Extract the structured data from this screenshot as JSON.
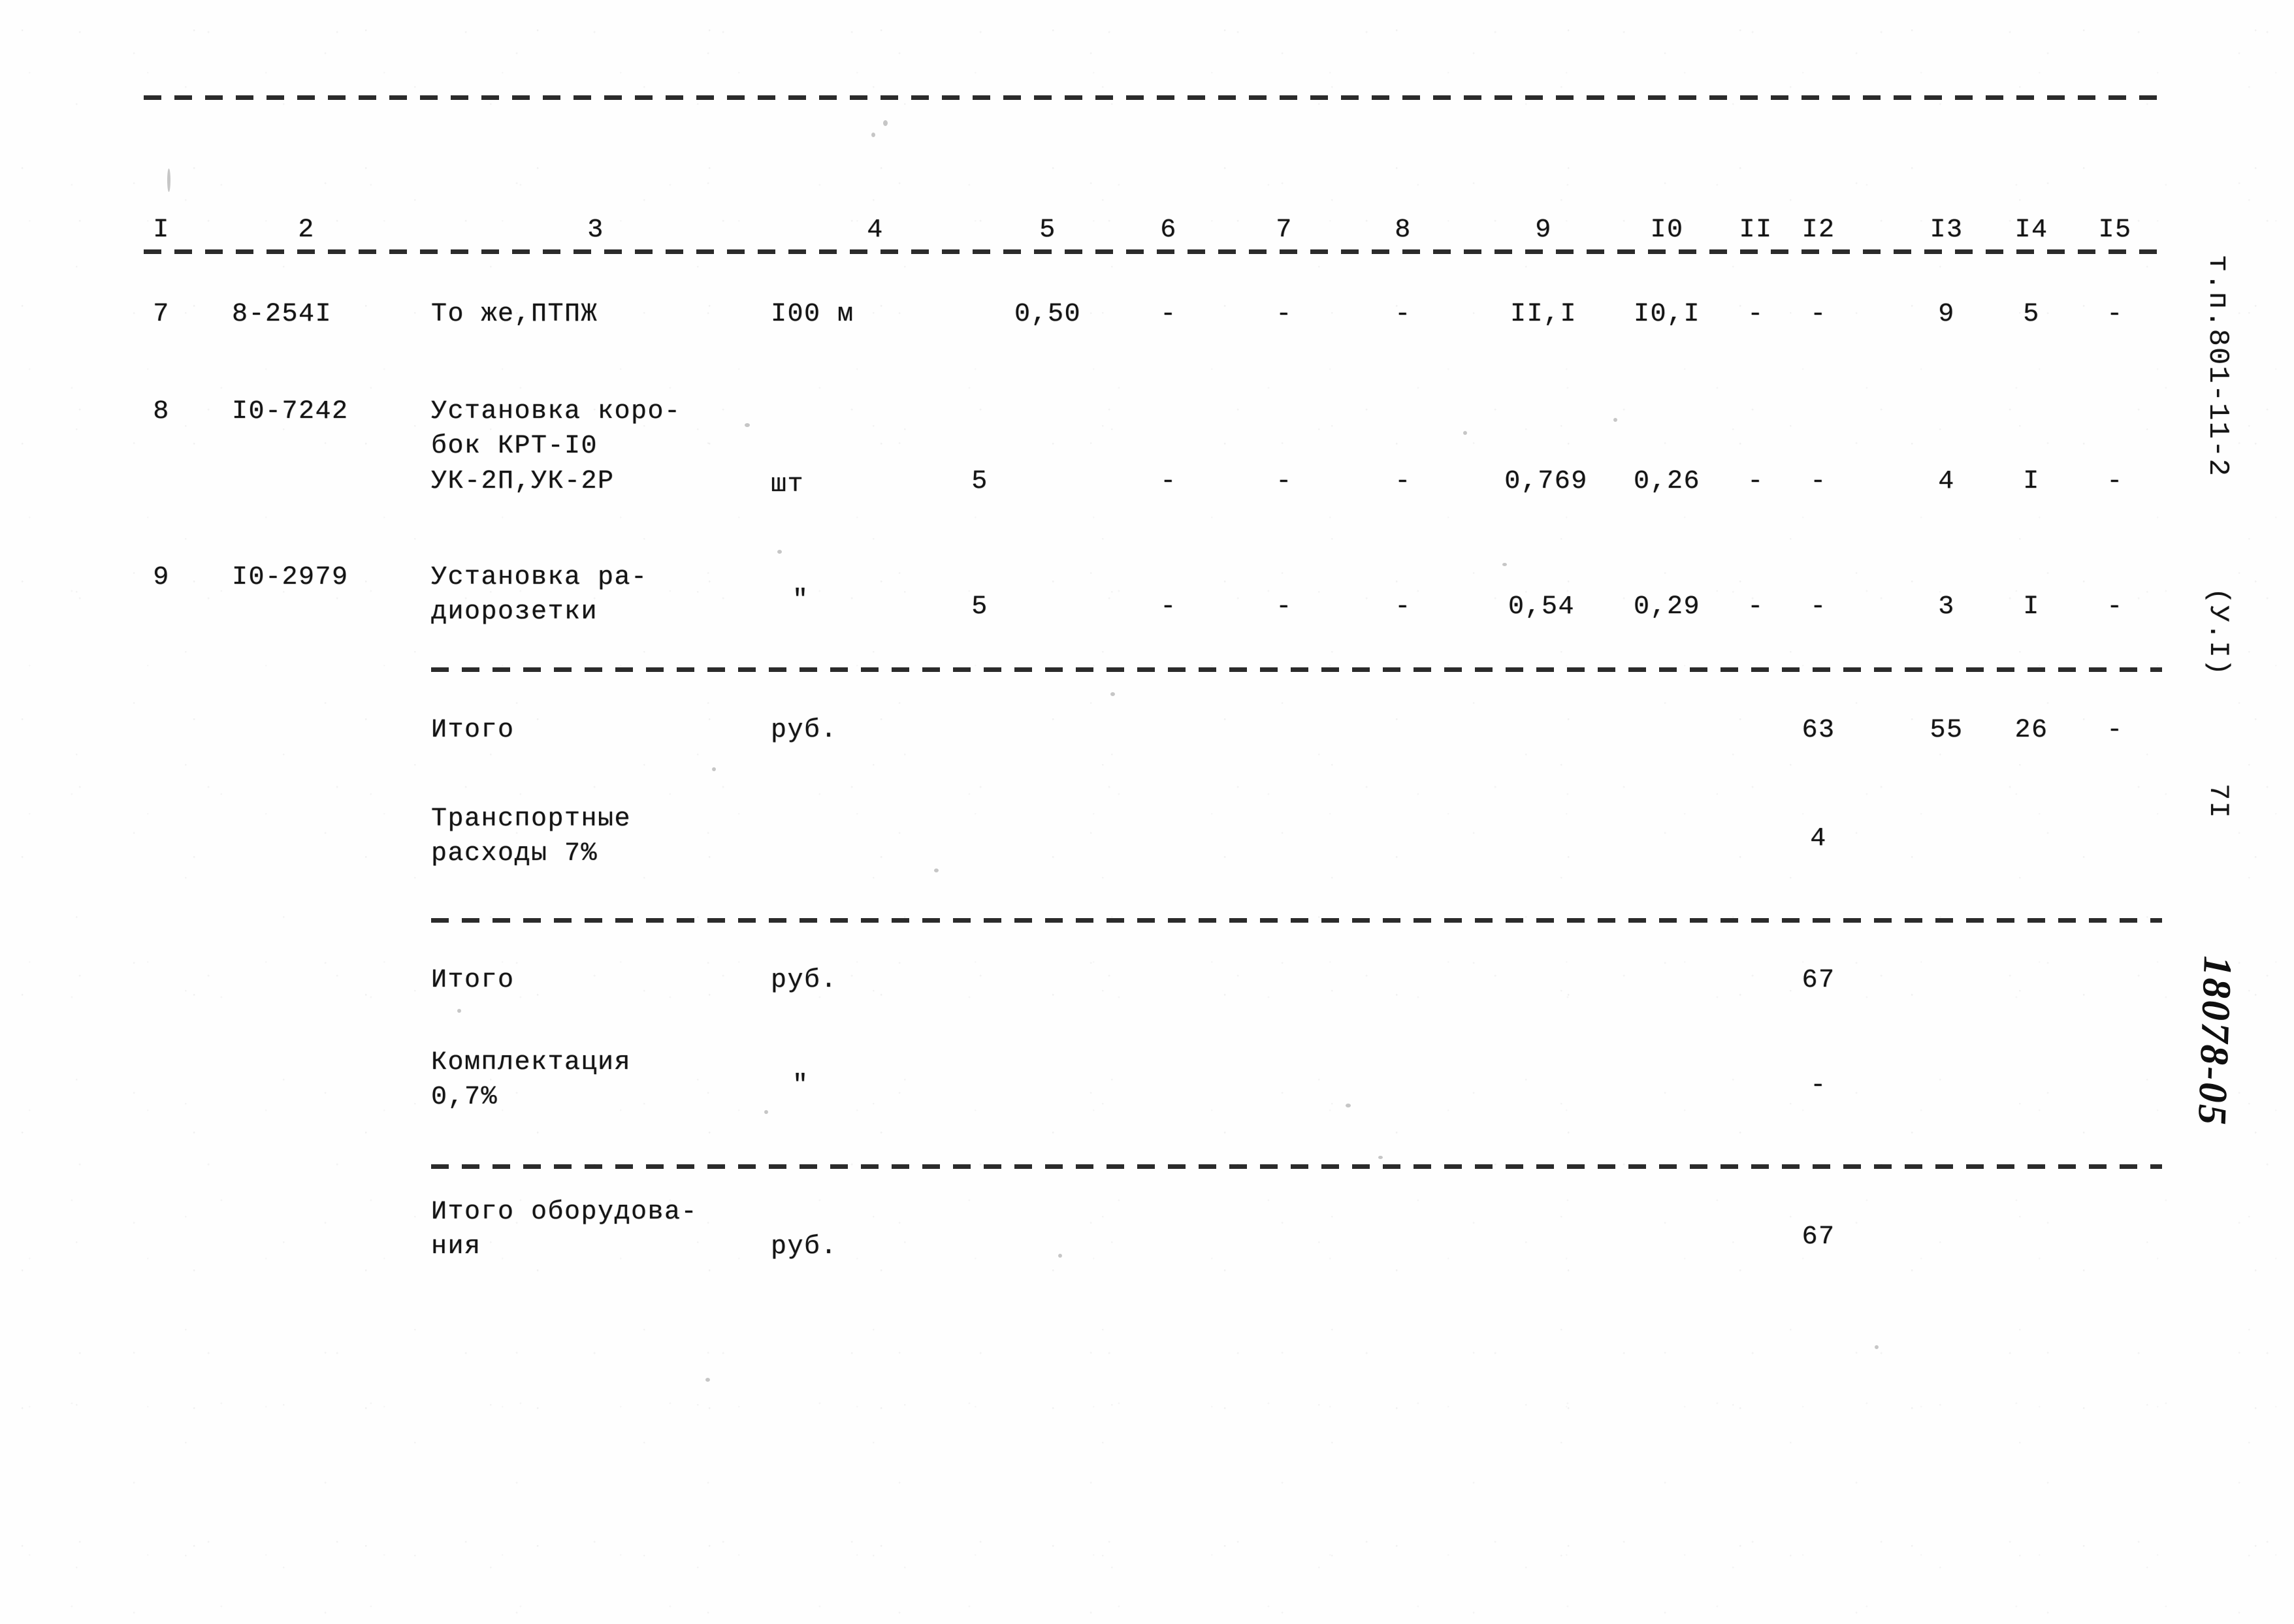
{
  "document": {
    "type": "construction-estimate-table",
    "language": "ru",
    "margin_stamp_top": "т.п.801-11-2",
    "margin_stamp_variant": "(У.I)",
    "margin_page_number": "7I",
    "margin_handwritten_code": "18078-05"
  },
  "table": {
    "column_headers": [
      "I",
      "2",
      "3",
      "4",
      "5",
      "6",
      "7",
      "8",
      "9",
      "I0",
      "II",
      "I2",
      "I3",
      "I4",
      "I5"
    ],
    "rows": [
      {
        "kind": "item",
        "no": "7",
        "code": "8-254I",
        "name_lines": [
          "То же,ПТПЖ"
        ],
        "unit": "I00 м",
        "qty": "0,50",
        "c6": "-",
        "c7": "-",
        "c8": "-",
        "c9": "II,I",
        "c10": "I0,I",
        "c11": "-",
        "c12": "-",
        "c13": "9",
        "c14": "5",
        "c15": "-"
      },
      {
        "kind": "item",
        "no": "8",
        "code": "I0-7242",
        "name_lines": [
          "Установка коро-",
          "бок КРТ-I0",
          "УК-2П,УК-2Р"
        ],
        "unit": "шт",
        "qty": "5",
        "c6": "-",
        "c7": "-",
        "c8": "-",
        "c9": "0,769",
        "c10": "0,26",
        "c11": "-",
        "c12": "-",
        "c13": "4",
        "c14": "I",
        "c15": "-"
      },
      {
        "kind": "item",
        "no": "9",
        "code": "I0-2979",
        "name_lines": [
          "Установка ра-",
          "диорозетки"
        ],
        "unit": "\"",
        "qty": "5",
        "c6": "-",
        "c7": "-",
        "c8": "-",
        "c9": "0,54",
        "c10": "0,29",
        "c11": "-",
        "c12": "-",
        "c13": "3",
        "c14": "I",
        "c15": "-"
      },
      {
        "kind": "total",
        "name_lines": [
          "Итого"
        ],
        "unit": "руб.",
        "c12": "63",
        "c13": "55",
        "c14": "26",
        "c15": "-"
      },
      {
        "kind": "total",
        "name_lines": [
          "Транспортные",
          "расходы 7%"
        ],
        "unit": "",
        "c12": "4"
      },
      {
        "kind": "total",
        "name_lines": [
          "Итого"
        ],
        "unit": "руб.",
        "c12": "67"
      },
      {
        "kind": "total",
        "name_lines": [
          "Комплектация",
          "0,7%"
        ],
        "unit": "\"",
        "c12": "-"
      },
      {
        "kind": "total",
        "name_lines": [
          "Итого оборудова-",
          "ния"
        ],
        "unit": "руб.",
        "c12": "67"
      }
    ]
  }
}
